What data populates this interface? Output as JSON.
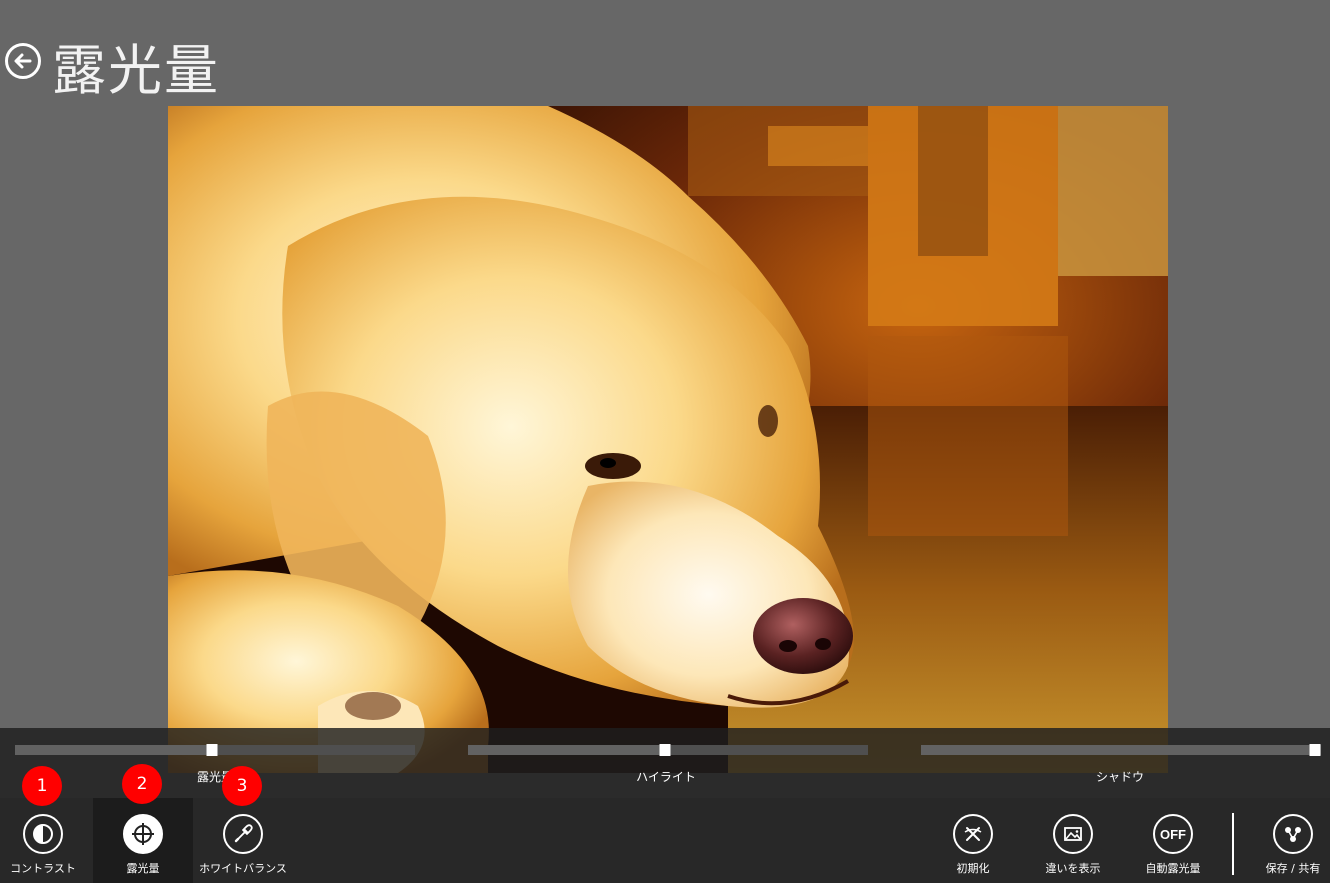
{
  "header": {
    "title": "露光量",
    "back_icon": "back-arrow-icon"
  },
  "sliders": [
    {
      "label": "露光量",
      "value": 0.5
    },
    {
      "label": "ハイライト",
      "value": 0.5
    },
    {
      "label": "シャドウ",
      "value": 1.0
    }
  ],
  "toolbar": {
    "left": [
      {
        "label": "コントラスト",
        "icon": "contrast-icon",
        "badge": "1"
      },
      {
        "label": "露光量",
        "icon": "exposure-crosshair-icon",
        "badge": "2",
        "selected": true
      },
      {
        "label": "ホワイトバランス",
        "icon": "eyedropper-icon",
        "badge": "3"
      }
    ],
    "right": [
      {
        "label": "初期化",
        "icon": "reset-icon"
      },
      {
        "label": "違いを表示",
        "icon": "compare-image-icon"
      },
      {
        "label": "自動露光量",
        "icon": "auto-exposure-off-icon",
        "icon_text": "OFF"
      },
      {
        "label": "保存 / 共有",
        "icon": "share-icon"
      }
    ]
  },
  "photo": {
    "subject": "golden-retriever-photo"
  }
}
